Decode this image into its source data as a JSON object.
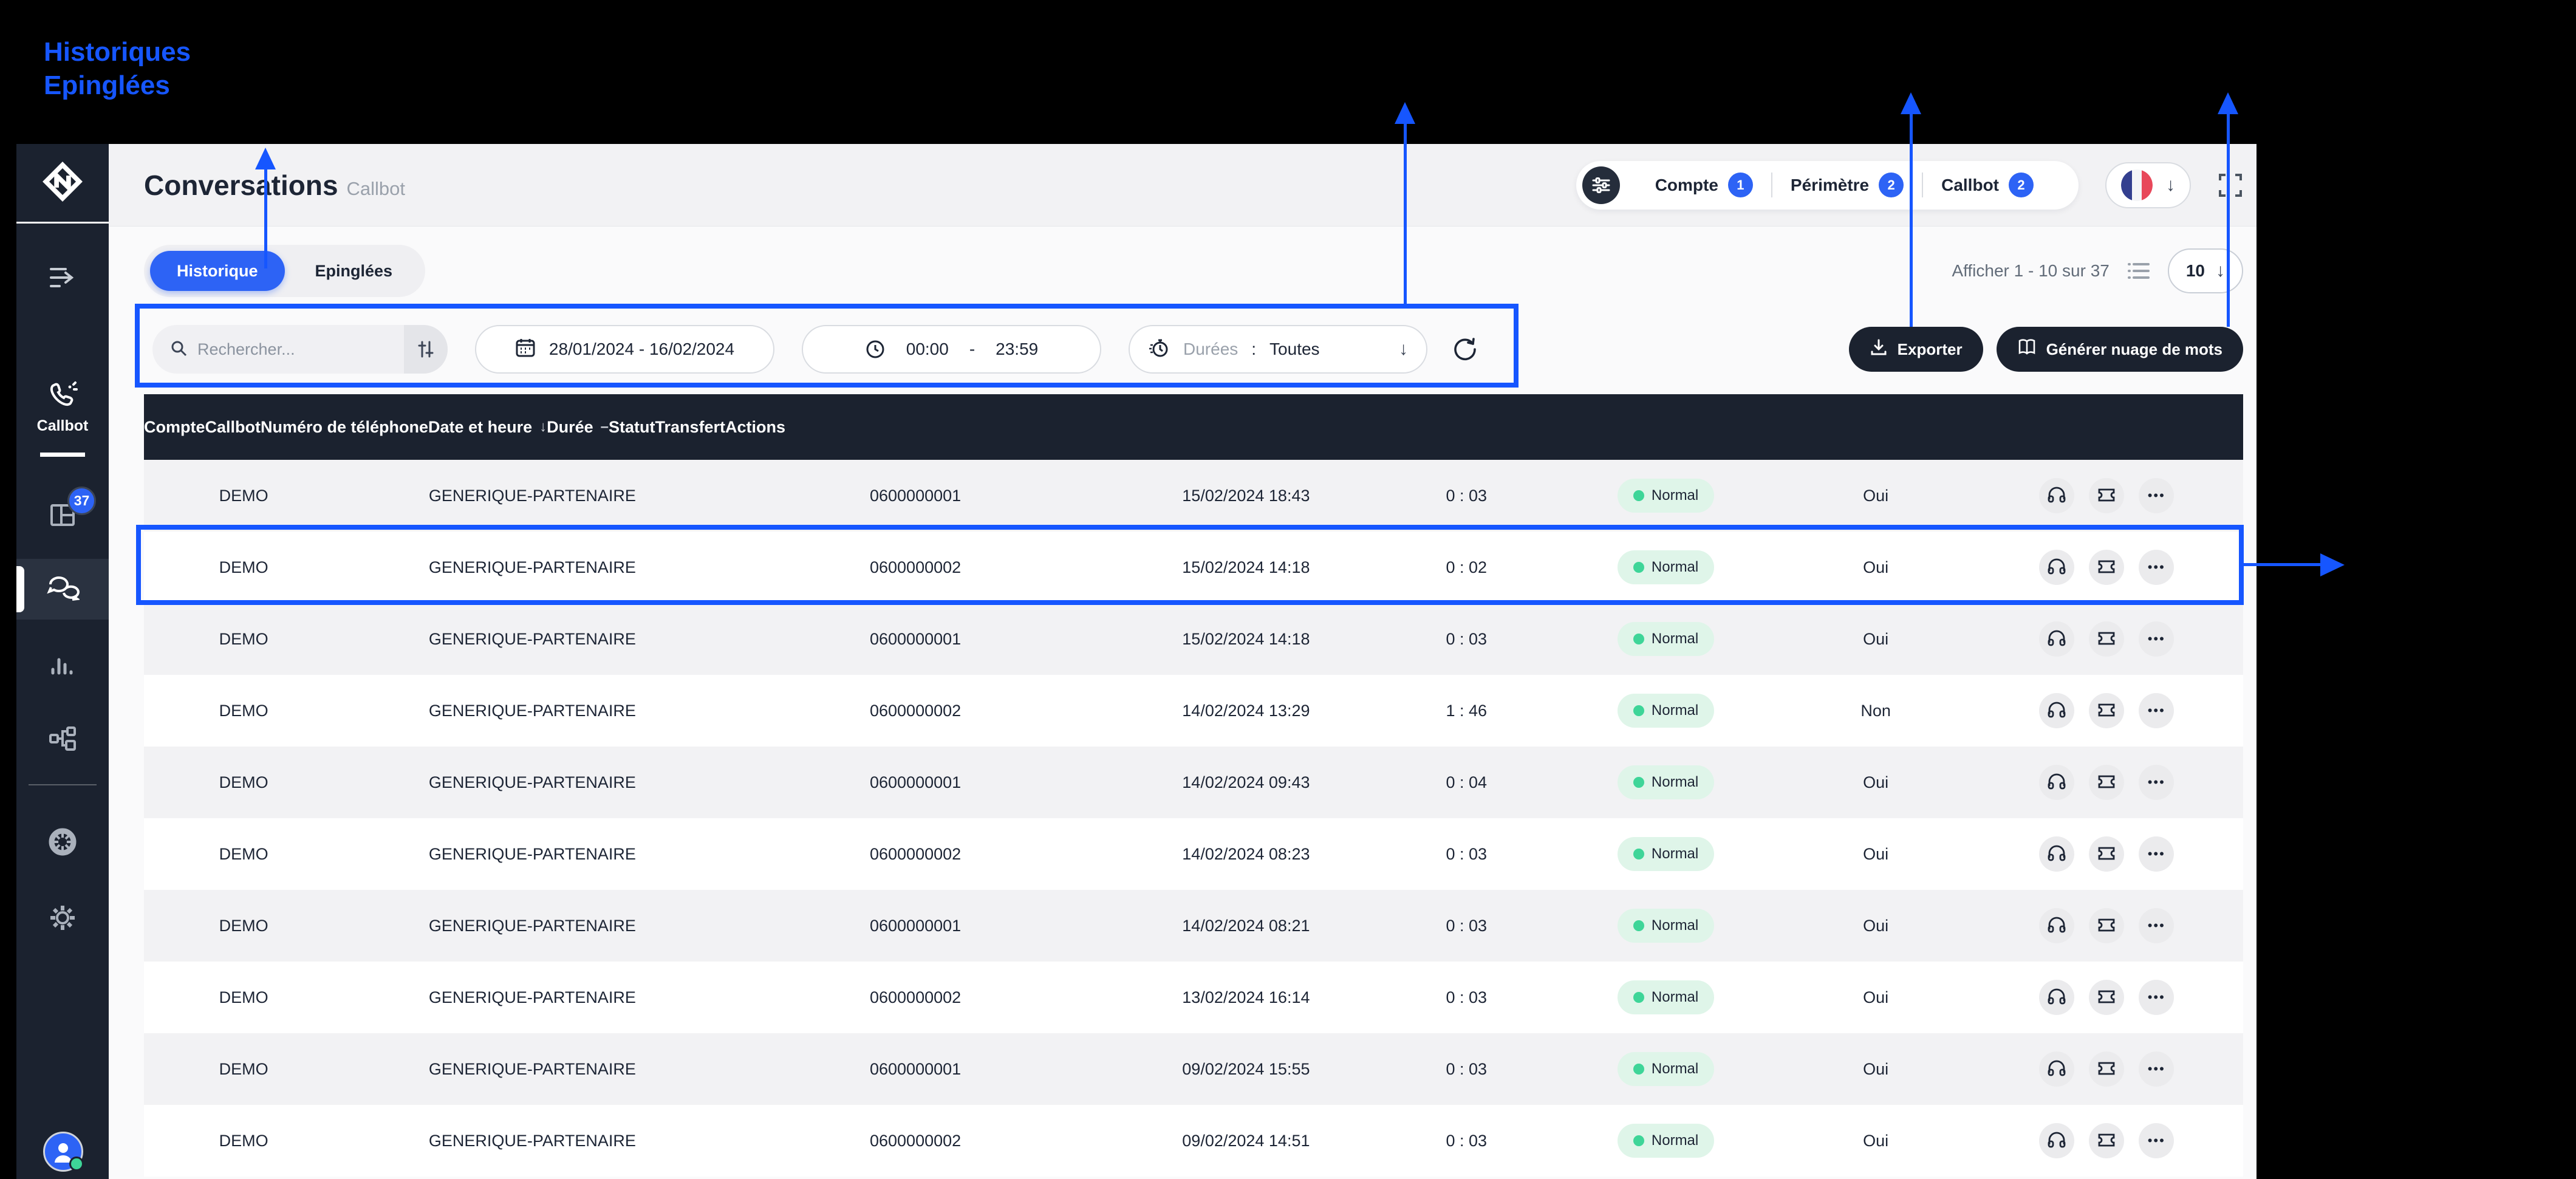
{
  "annotations": {
    "line1": "Historiques",
    "line2": "Epinglées"
  },
  "colors": {
    "annotation_blue": "#1656ff",
    "accent_blue": "#2d63f5",
    "sidebar_dark": "#1b222f",
    "status_green": "#3ed598",
    "status_bg": "#dff5e9"
  },
  "sidebar": {
    "section_label": "Callbot",
    "badge": "37",
    "icons": [
      "app-logo-icon",
      "collapse-icon",
      "phone-icon",
      "grid-icon",
      "chat-bubbles-icon",
      "bar-chart-icon",
      "org-chart-icon",
      "wheel-icon",
      "gear-icon",
      "user-avatar"
    ]
  },
  "header": {
    "title": "Conversations",
    "subtitle": "Callbot",
    "scopes": [
      {
        "label": "Compte",
        "count": "1"
      },
      {
        "label": "Périmètre",
        "count": "2"
      },
      {
        "label": "Callbot",
        "count": "2"
      }
    ],
    "language_flag": "france",
    "icons": [
      "filter-sliders-icon",
      "french-flag-icon",
      "chevron-down-icon",
      "fullscreen-icon"
    ]
  },
  "tabs": [
    {
      "label": "Historique",
      "active": true
    },
    {
      "label": "Epinglées",
      "active": false
    }
  ],
  "pagination": {
    "summary": "Afficher 1 - 10 sur 37",
    "page_size": "10"
  },
  "filters": {
    "search_placeholder": "Rechercher...",
    "date_range": "28/01/2024 - 16/02/2024",
    "time_start": "00:00",
    "time_separator": "-",
    "time_end": "23:59",
    "durations_label": "Durées",
    "durations_separator": ":",
    "durations_value": "Toutes"
  },
  "buttons": {
    "export": "Exporter",
    "wordcloud": "Générer nuage de mots"
  },
  "table": {
    "headers": [
      {
        "label": "Compte"
      },
      {
        "label": "Callbot"
      },
      {
        "label": "Numéro de téléphone"
      },
      {
        "label": "Date et heure",
        "sort": "↓"
      },
      {
        "label": "Durée",
        "sort": "–"
      },
      {
        "label": "Statut"
      },
      {
        "label": "Transfert"
      },
      {
        "label": "Actions"
      }
    ],
    "rows": [
      {
        "compte": "DEMO",
        "callbot": "GENERIQUE-PARTENAIRE",
        "phone": "0600000001",
        "datetime": "15/02/2024 18:43",
        "duration": "0 : 03",
        "status": "Normal",
        "transfer": "Oui",
        "highlighted": false
      },
      {
        "compte": "DEMO",
        "callbot": "GENERIQUE-PARTENAIRE",
        "phone": "0600000002",
        "datetime": "15/02/2024 14:18",
        "duration": "0 : 02",
        "status": "Normal",
        "transfer": "Oui",
        "highlighted": true
      },
      {
        "compte": "DEMO",
        "callbot": "GENERIQUE-PARTENAIRE",
        "phone": "0600000001",
        "datetime": "15/02/2024 14:18",
        "duration": "0 : 03",
        "status": "Normal",
        "transfer": "Oui",
        "highlighted": false
      },
      {
        "compte": "DEMO",
        "callbot": "GENERIQUE-PARTENAIRE",
        "phone": "0600000002",
        "datetime": "14/02/2024 13:29",
        "duration": "1 : 46",
        "status": "Normal",
        "transfer": "Non",
        "highlighted": false
      },
      {
        "compte": "DEMO",
        "callbot": "GENERIQUE-PARTENAIRE",
        "phone": "0600000001",
        "datetime": "14/02/2024 09:43",
        "duration": "0 : 04",
        "status": "Normal",
        "transfer": "Oui",
        "highlighted": false
      },
      {
        "compte": "DEMO",
        "callbot": "GENERIQUE-PARTENAIRE",
        "phone": "0600000002",
        "datetime": "14/02/2024 08:23",
        "duration": "0 : 03",
        "status": "Normal",
        "transfer": "Oui",
        "highlighted": false
      },
      {
        "compte": "DEMO",
        "callbot": "GENERIQUE-PARTENAIRE",
        "phone": "0600000001",
        "datetime": "14/02/2024 08:21",
        "duration": "0 : 03",
        "status": "Normal",
        "transfer": "Oui",
        "highlighted": false
      },
      {
        "compte": "DEMO",
        "callbot": "GENERIQUE-PARTENAIRE",
        "phone": "0600000002",
        "datetime": "13/02/2024 16:14",
        "duration": "0 : 03",
        "status": "Normal",
        "transfer": "Oui",
        "highlighted": false
      },
      {
        "compte": "DEMO",
        "callbot": "GENERIQUE-PARTENAIRE",
        "phone": "0600000001",
        "datetime": "09/02/2024 15:55",
        "duration": "0 : 03",
        "status": "Normal",
        "transfer": "Oui",
        "highlighted": false
      },
      {
        "compte": "DEMO",
        "callbot": "GENERIQUE-PARTENAIRE",
        "phone": "0600000002",
        "datetime": "09/02/2024 14:51",
        "duration": "0 : 03",
        "status": "Normal",
        "transfer": "Oui",
        "highlighted": false
      }
    ],
    "action_icons": [
      "headphones-icon",
      "ticket-icon",
      "more-options-icon"
    ]
  }
}
